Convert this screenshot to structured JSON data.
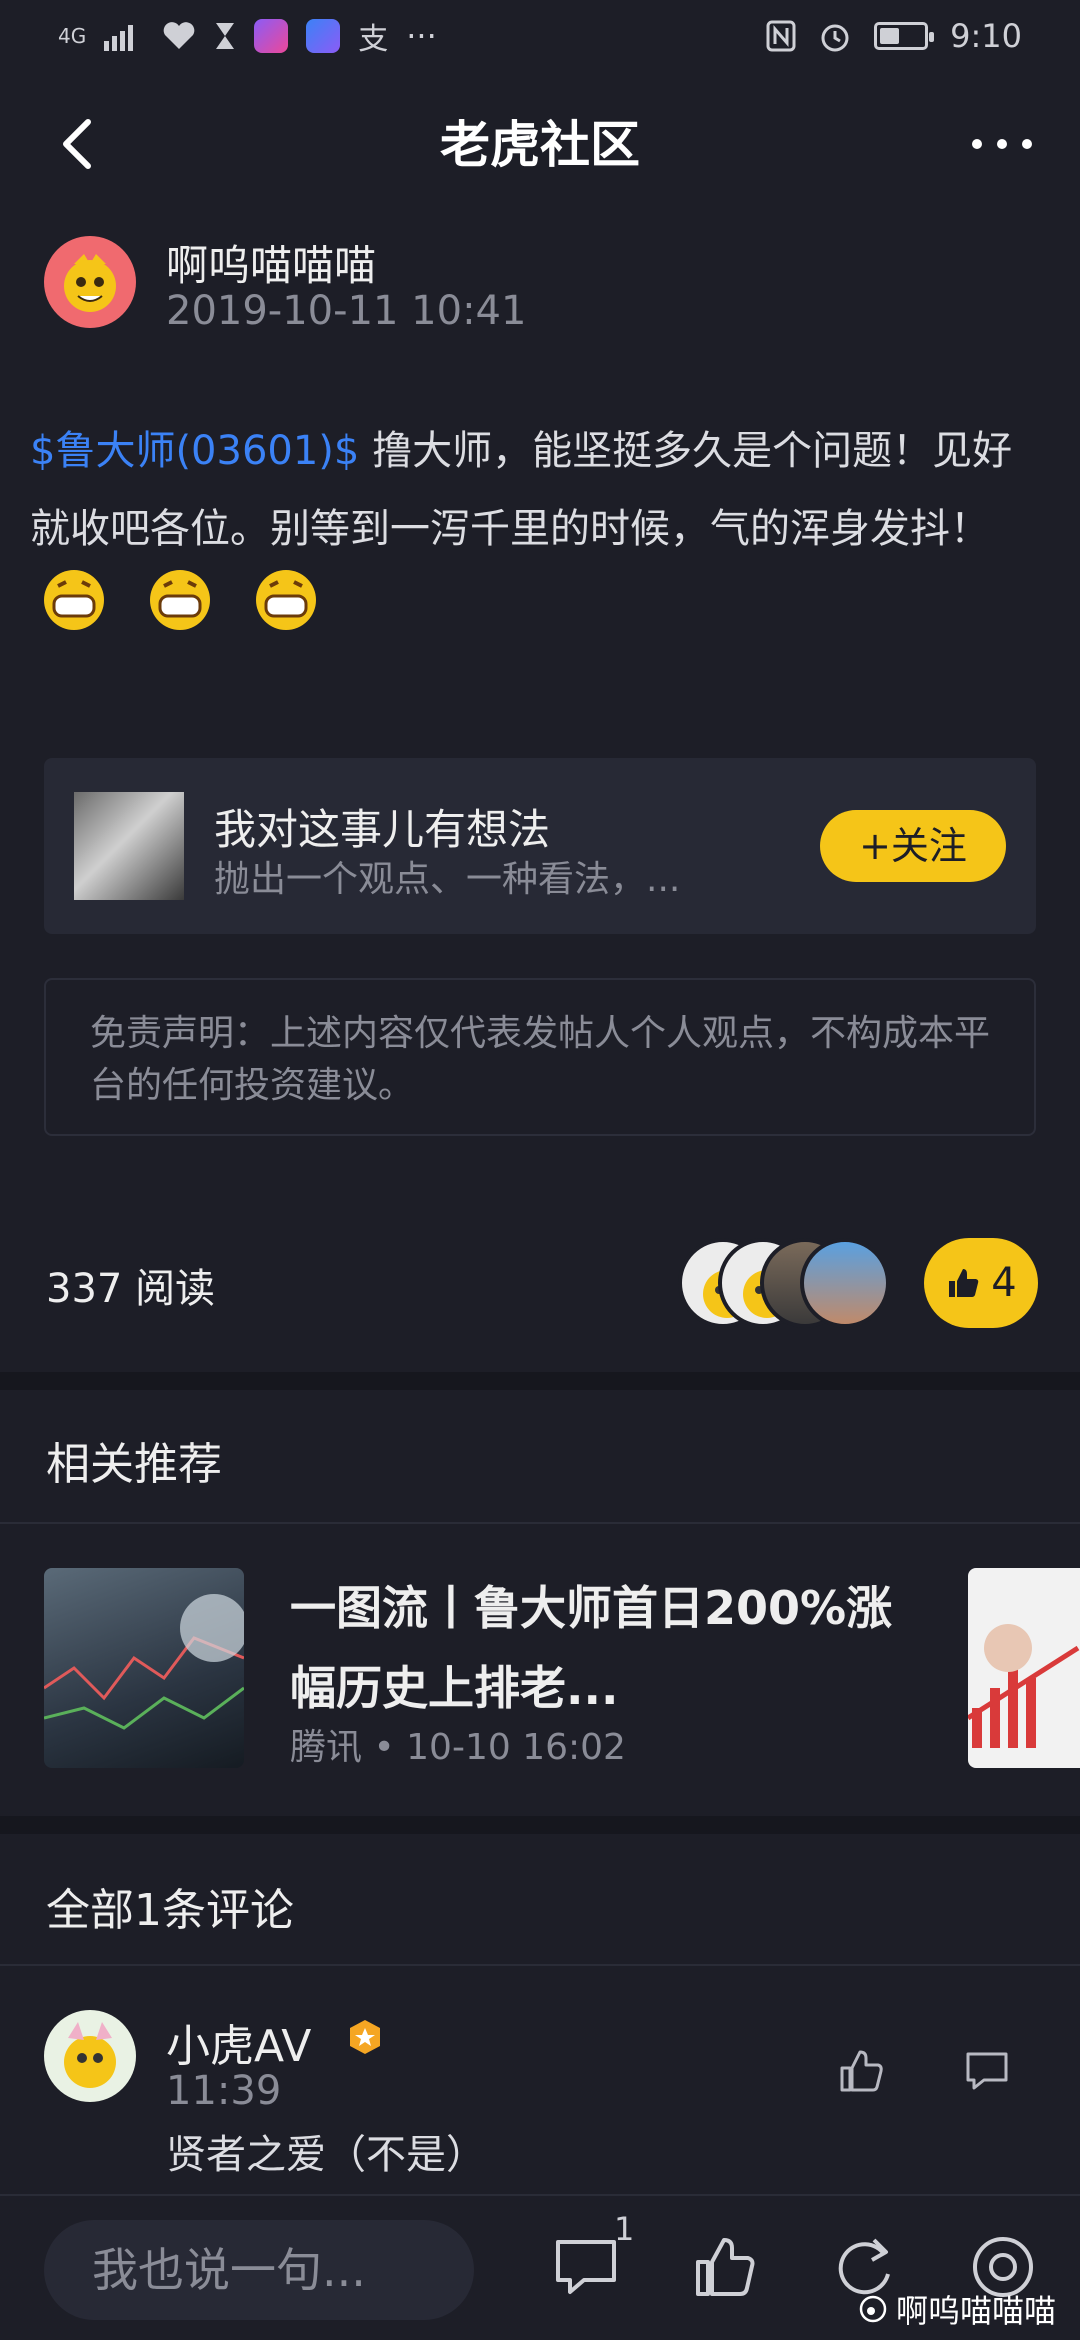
{
  "status_bar": {
    "signal": "4G",
    "time": "9:10",
    "battery_fraction": 0.45,
    "left_icons": [
      "signal-icon",
      "health-icon",
      "hourglass-icon",
      "video-app-icon",
      "stock-app-icon",
      "alipay-icon",
      "more-dots"
    ],
    "right_icons": [
      "nfc-icon",
      "alarm-icon",
      "battery-icon"
    ]
  },
  "nav": {
    "title": "老虎社区"
  },
  "post": {
    "author": "啊呜喵喵喵",
    "time": "2019-10-11 10:41",
    "stock_tag": "$鲁大师(03601)$",
    "text": " 撸大师，能坚挺多久是个问题！见好就收吧各位。别等到一泻千里的时候，气的浑身发抖！",
    "emoji_count": 3
  },
  "follow_card": {
    "title": "我对这事儿有想法",
    "subtitle": "抛出一个观点、一种看法，...",
    "button": "+关注"
  },
  "disclaimer": "免责声明：上述内容仅代表发帖人个人观点，不构成本平台的任何投资建议。",
  "stats": {
    "reads": "337 阅读",
    "likes": "4"
  },
  "related": {
    "heading": "相关推荐",
    "item": {
      "title": "一图流丨鲁大师首日200%涨幅历史上排老...",
      "source": "腾讯",
      "separator": "•",
      "time": "10-10 16:02"
    }
  },
  "comments": {
    "heading": "全部1条评论",
    "items": [
      {
        "name": "小虎AV",
        "time": "11:39",
        "text": "贤者之爱（不是）"
      }
    ]
  },
  "bottom_bar": {
    "input_placeholder": "我也说一句...",
    "comment_count": "1",
    "watermark": "啊呜喵喵喵"
  },
  "colors": {
    "background": "#1d1e27",
    "card": "#272935",
    "accent_yellow": "#f5c518",
    "link_blue": "#3b82f6",
    "muted_text": "#8a8c97"
  }
}
